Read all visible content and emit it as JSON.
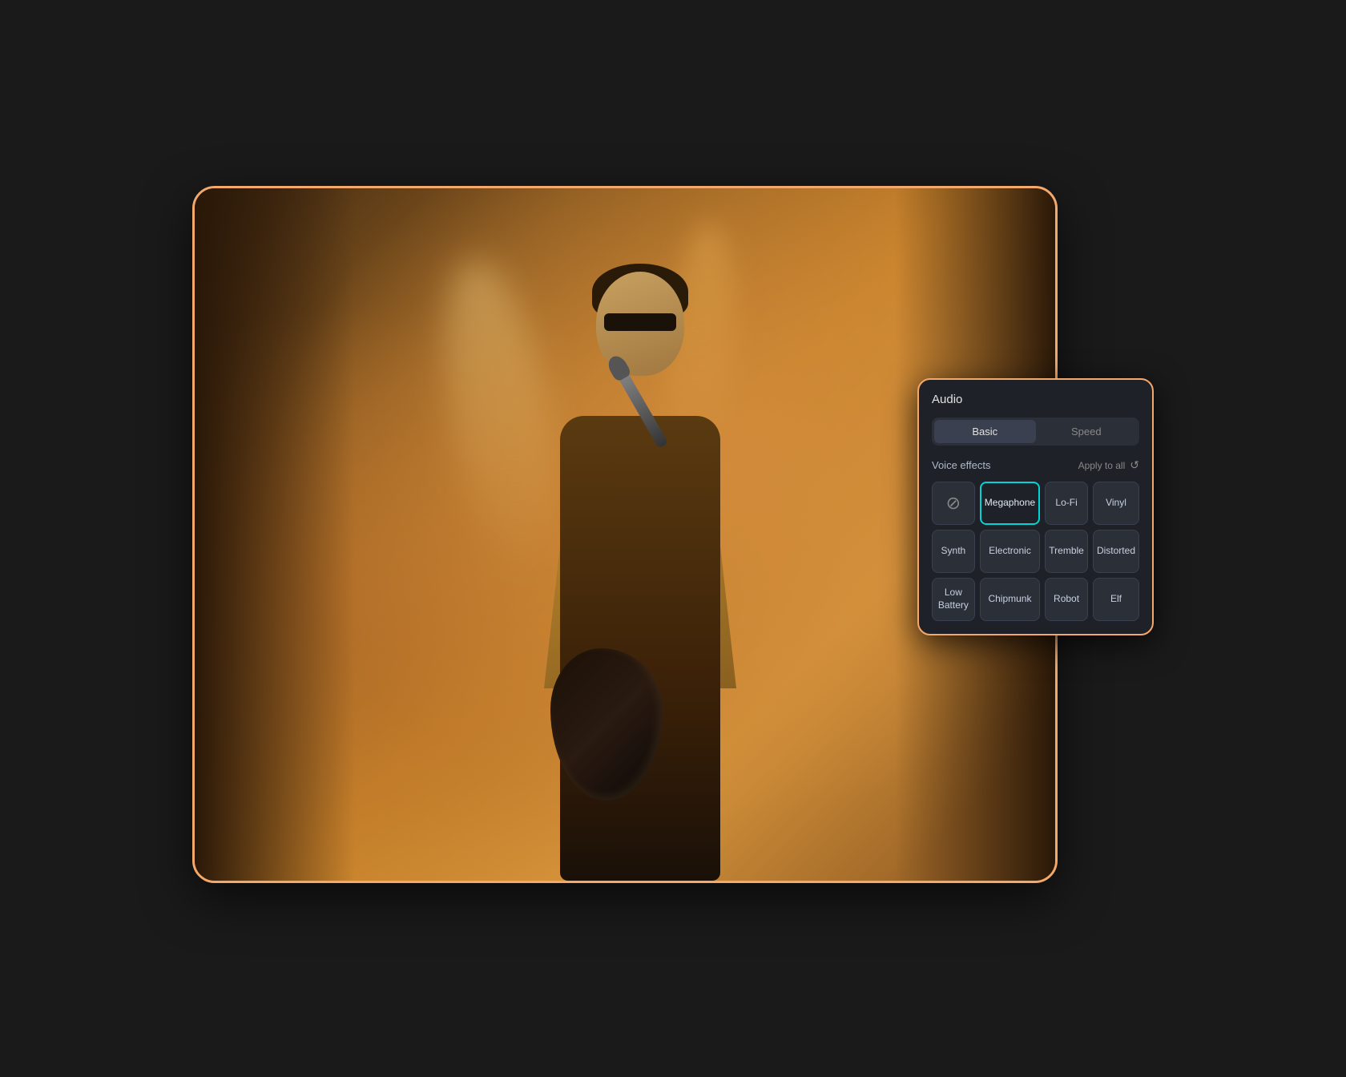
{
  "panel": {
    "title": "Audio",
    "tabs": [
      {
        "id": "basic",
        "label": "Basic",
        "active": true
      },
      {
        "id": "speed",
        "label": "Speed",
        "active": false
      }
    ],
    "voice_effects_label": "Voice effects",
    "apply_to_all_label": "Apply to all",
    "reset_icon": "↺",
    "effects": [
      {
        "id": "none",
        "label": "",
        "type": "no-effect",
        "selected": false
      },
      {
        "id": "megaphone",
        "label": "Megaphone",
        "type": "normal",
        "selected": true
      },
      {
        "id": "lofi",
        "label": "Lo-Fi",
        "type": "normal",
        "selected": false
      },
      {
        "id": "vinyl",
        "label": "Vinyl",
        "type": "normal",
        "selected": false
      },
      {
        "id": "synth",
        "label": "Synth",
        "type": "normal",
        "selected": false
      },
      {
        "id": "electronic",
        "label": "Electronic",
        "type": "normal",
        "selected": false
      },
      {
        "id": "tremble",
        "label": "Tremble",
        "type": "normal",
        "selected": false
      },
      {
        "id": "distorted",
        "label": "Distorted",
        "type": "normal",
        "selected": false
      },
      {
        "id": "low-battery",
        "label": "Low Battery",
        "type": "normal",
        "selected": false
      },
      {
        "id": "chipmunk",
        "label": "Chipmunk",
        "type": "normal",
        "selected": false
      },
      {
        "id": "robot",
        "label": "Robot",
        "type": "normal",
        "selected": false
      },
      {
        "id": "elf",
        "label": "Elf",
        "type": "normal",
        "selected": false
      }
    ]
  },
  "colors": {
    "accent_border": "#f4a96a",
    "selected_effect_border": "#00d4d4",
    "panel_bg": "#1e2228"
  }
}
